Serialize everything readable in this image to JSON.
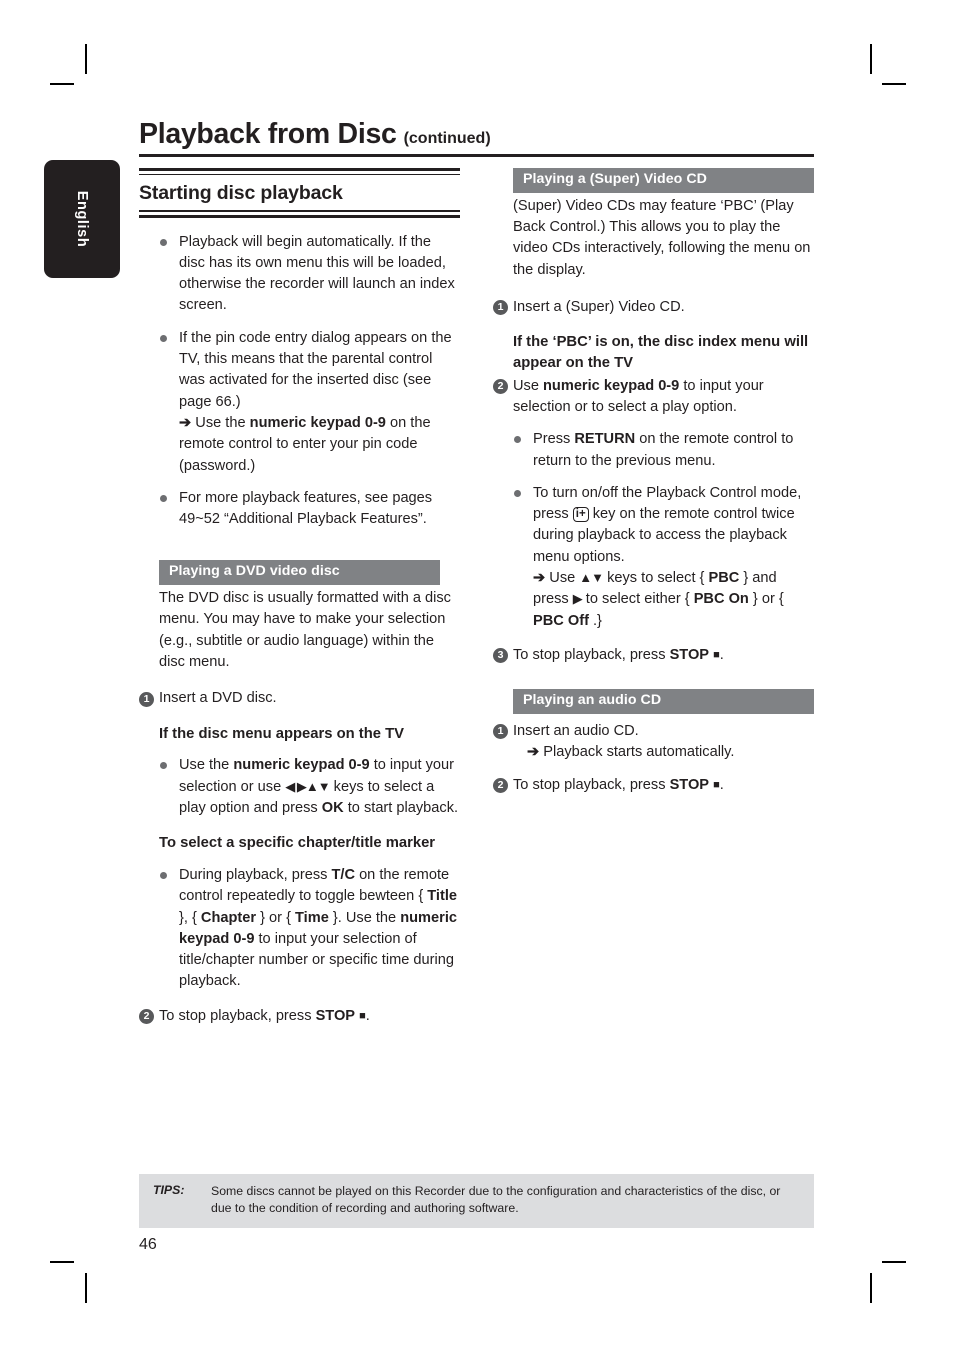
{
  "page": {
    "title_main": "Playback from Disc",
    "title_sub": "(continued)",
    "language_tab": "English",
    "page_number": "46"
  },
  "left_column": {
    "section_title": "Starting disc playback",
    "bullets": [
      "Playback will begin automatically. If the disc has its own menu this will be loaded, otherwise the recorder will launch an index screen.",
      "If the pin code entry dialog appears on the TV, this means that the parental control was activated for the inserted disc (see page 66.)",
      "For more playback features, see pages 49~52 “Additional Playback Features”."
    ],
    "pin_arrow_line": {
      "arrow": "➔",
      "pre": "Use the ",
      "bold": "numeric keypad 0-9",
      "post": " on the remote control to enter your pin code (password.)"
    },
    "dvd_section": {
      "bar_title": "Playing a DVD video disc",
      "intro": "The DVD disc is usually formatted with a disc menu. You may have to make your selection (e.g., subtitle or audio language) within the disc menu.",
      "step1_num": "1",
      "step1_text": "Insert a DVD disc.",
      "subhead1": "If the disc menu appears on the TV",
      "bullet_keypad": {
        "p1": "Use the ",
        "b1": "numeric keypad 0-9",
        "p2": " to input your selection or use ",
        "keys": "◀ ▶▲▼",
        "p3": " keys to select a play option and press ",
        "b2": "OK",
        "p4": " to start playback."
      },
      "subhead2": "To select a specific chapter/title marker",
      "bullet_tc": {
        "p1": "During playback, press ",
        "b1": "T/C",
        "p2": " on the remote control repeatedly to toggle bewteen { ",
        "b2": "Title",
        "p3": " }, { ",
        "b3": "Chapter",
        "p4": " } or { ",
        "b4": "Time",
        "p5": " }. Use the ",
        "b5": "numeric keypad 0-9",
        "p6": " to input your selection of title/chapter number or specific time during playback."
      },
      "step2_num": "2",
      "step2_pre": "To stop playback, press ",
      "step2_bold": "STOP",
      "step2_glyph": "■",
      "step2_post": "."
    }
  },
  "right_column": {
    "svcd_section": {
      "bar_title": "Playing a (Super) Video CD",
      "intro": "(Super) Video CDs may feature ‘PBC’ (Play Back Control.) This allows you to play the video CDs interactively, following the menu on the display.",
      "step1_num": "1",
      "step1_text": "Insert a (Super) Video CD.",
      "subhead": "If the ‘PBC’ is on, the disc index menu will appear on the TV",
      "step2_num": "2",
      "step2": {
        "p1": "Use ",
        "b1": "numeric keypad 0-9",
        "p2": " to input your selection or to select a play option."
      },
      "bullet_return": {
        "p1": "Press ",
        "b1": "RETURN",
        "p2": " on the remote control to return to the previous menu."
      },
      "bullet_pbc": {
        "p1": "To turn on/off the Playback Control mode, press ",
        "icon": "i+",
        "p2": " key on the remote control twice during playback to access the playback menu options.",
        "arrow": "➔",
        "a1": " Use ",
        "keys1": "▲▼",
        "a2": " keys to select { ",
        "b1": "PBC",
        "a3": " } and press ",
        "keys2": "▶",
        "a4": " to select either { ",
        "b2": "PBC On",
        "a5": " } or { ",
        "b3": "PBC Off",
        "a6": " .}"
      },
      "step3_num": "3",
      "step3_pre": "To stop playback, press ",
      "step3_bold": "STOP",
      "step3_glyph": "■",
      "step3_post": "."
    },
    "audio_cd_section": {
      "bar_title": "Playing an audio CD",
      "step1_num": "1",
      "step1_text": "Insert an audio CD.",
      "step1_arrow": "➔",
      "step1_sub": "Playback starts automatically.",
      "step2_num": "2",
      "step2_pre": "To stop playback, press ",
      "step2_bold": "STOP",
      "step2_glyph": "■",
      "step2_post": "."
    }
  },
  "tips": {
    "label": "TIPS:",
    "text": "Some discs cannot be played on this Recorder due to the configuration and characteristics of the disc, or due to the condition of recording and authoring software."
  },
  "colors": {
    "bar_gray": "#808285",
    "tips_gray": "#dcdddf",
    "ink": "#231f20",
    "bullet_gray": "#6d6e71"
  }
}
